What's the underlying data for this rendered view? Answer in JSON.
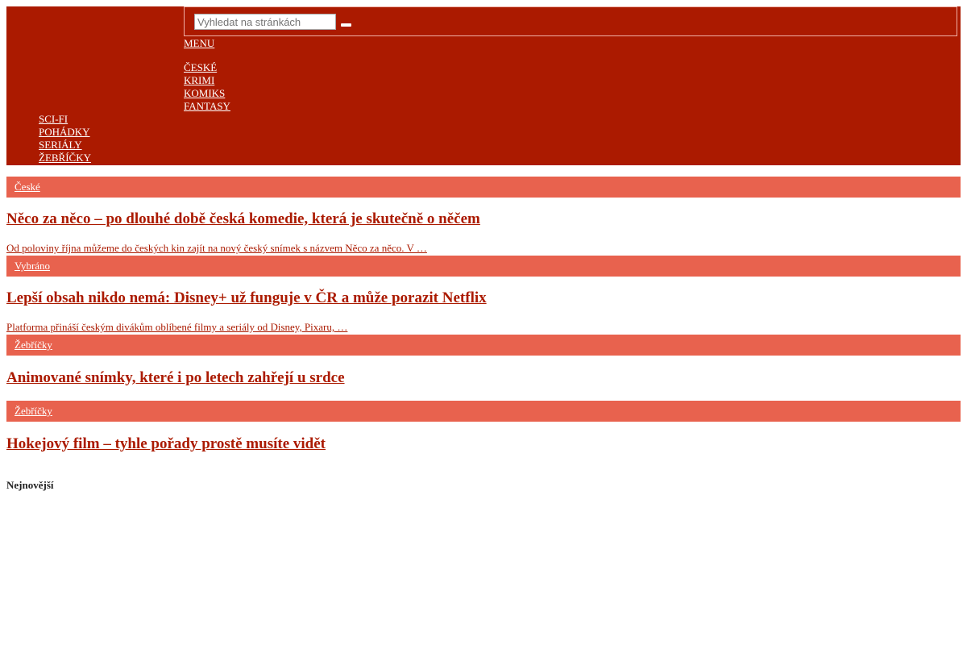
{
  "search": {
    "placeholder": "Vyhledat na stránkách",
    "value": ""
  },
  "header": {
    "menu_label": "MENU",
    "nav_items": [
      "ČESKÉ",
      "KRIMI",
      "KOMIKS",
      "FANTASY",
      "SCI-FI",
      "POHÁDKY",
      "SERIÁLY",
      "ŽEBŘÍČKY"
    ]
  },
  "articles": [
    {
      "category": "České",
      "title": "Něco za něco – po dlouhé době česká komedie, která je skutečně o něčem",
      "excerpt": "Od poloviny října můžeme do českých kin zajít na nový český snímek s názvem Něco za něco. V …"
    },
    {
      "category": "Vybráno",
      "title": "Lepší obsah nikdo nemá: Disney+ už funguje v ČR a může porazit Netflix",
      "excerpt": "Platforma přináší českým divákům oblíbené filmy a seriály od Disney, Pixaru, …"
    },
    {
      "category": "Žebříčky",
      "title": "Animované snímky, které i po letech zahřejí u srdce",
      "excerpt": ""
    },
    {
      "category": "Žebříčky",
      "title": "Hokejový film – tyhle pořady prostě musíte vidět",
      "excerpt": ""
    }
  ],
  "latest_heading": "Nejnovější",
  "colors": {
    "header_bg": "#ab1a00",
    "category_bg": "#e8624e",
    "link": "#ab1a00"
  }
}
